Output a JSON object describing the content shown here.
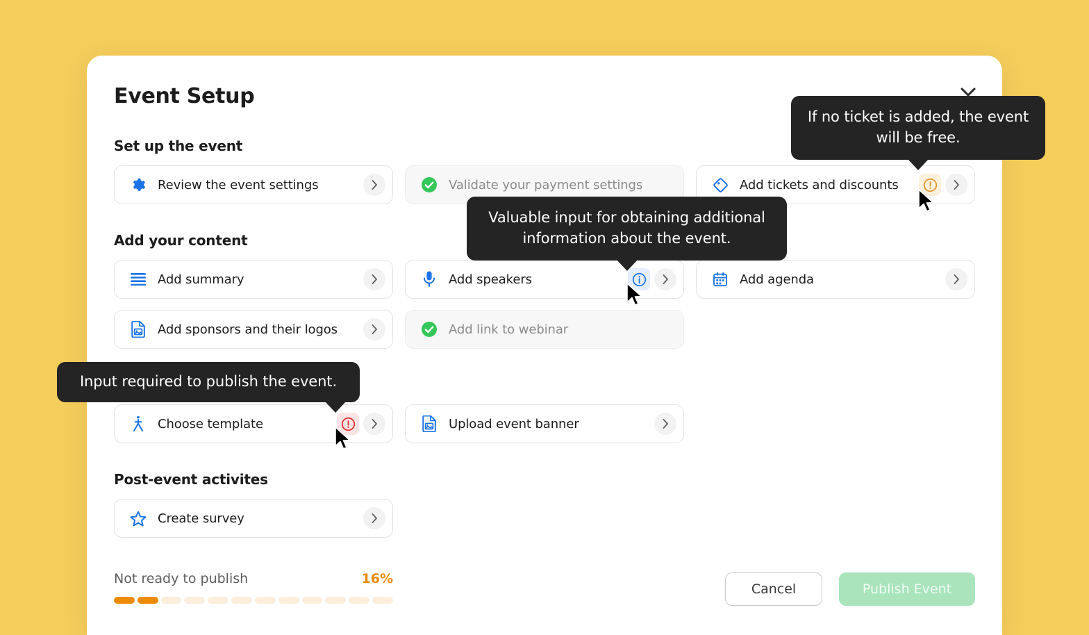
{
  "window": {
    "background_color": "#F5CD5B",
    "card_background": "#FFFFFF"
  },
  "header": {
    "title": "Event Setup",
    "close_icon": "chevron-down-close-icon"
  },
  "sections": [
    {
      "id": "set-up-the-event",
      "title": "Set up the event",
      "tasks": [
        {
          "id": "review-event-settings",
          "label": "Review the event settings",
          "icon": "gear-icon",
          "state": "todo",
          "badge": null,
          "chevron": true
        },
        {
          "id": "validate-payment-settings",
          "label": "Validate your payment settings",
          "icon": "check-circle-icon",
          "state": "done",
          "badge": null,
          "chevron": false
        },
        {
          "id": "add-tickets-and-discounts",
          "label": "Add tickets and discounts",
          "icon": "ticket-icon",
          "state": "todo",
          "badge": "warning",
          "chevron": true
        }
      ]
    },
    {
      "id": "add-your-content",
      "title": "Add your content",
      "tasks": [
        {
          "id": "add-summary",
          "label": "Add summary",
          "icon": "list-icon",
          "state": "todo",
          "badge": null,
          "chevron": true
        },
        {
          "id": "add-speakers",
          "label": "Add speakers",
          "icon": "microphone-icon",
          "state": "todo",
          "badge": "info",
          "chevron": true
        },
        {
          "id": "add-agenda",
          "label": "Add agenda",
          "icon": "calendar-icon",
          "state": "todo",
          "badge": null,
          "chevron": true
        },
        {
          "id": "add-sponsors-and-their-logos",
          "label": "Add sponsors and their logos",
          "icon": "image-file-icon",
          "state": "todo",
          "badge": null,
          "chevron": true
        },
        {
          "id": "add-link-to-webinar",
          "label": "Add link to webinar",
          "icon": "check-circle-icon",
          "state": "done",
          "badge": null,
          "chevron": false
        }
      ]
    },
    {
      "id": "design",
      "title": "",
      "tasks": [
        {
          "id": "choose-template",
          "label": "Choose template",
          "icon": "template-icon",
          "state": "todo",
          "badge": "error",
          "chevron": true
        },
        {
          "id": "upload-event-banner",
          "label": "Upload event banner",
          "icon": "image-file-icon",
          "state": "todo",
          "badge": null,
          "chevron": true
        }
      ]
    },
    {
      "id": "post-event-activites",
      "title": "Post-event activites",
      "tasks": [
        {
          "id": "create-survey",
          "label": "Create survey",
          "icon": "star-icon",
          "state": "todo",
          "badge": null,
          "chevron": true
        }
      ]
    }
  ],
  "tooltips": [
    {
      "id": "tickets-tooltip",
      "text": "If no ticket is added, the event will be free."
    },
    {
      "id": "speakers-tooltip",
      "text": "Valuable input for obtaining additional information about the event."
    },
    {
      "id": "template-tooltip",
      "text": "Input required to publish the event."
    }
  ],
  "footer": {
    "status_text": "Not ready to publish",
    "progress_percent": "16%",
    "progress_segments_total": 12,
    "progress_segments_filled": 2,
    "progress_fill_color": "#EE8A06",
    "progress_track_color": "#FCEEDD",
    "cancel_label": "Cancel",
    "publish_label": "Publish Event",
    "publish_disabled": true
  },
  "colors": {
    "accent_blue": "#1A73E8",
    "success_green": "#34C759",
    "warning_orange": "#E2942C",
    "error_red": "#E02B2B",
    "progress_orange": "#EE8A06",
    "tooltip_bg": "#242424"
  }
}
